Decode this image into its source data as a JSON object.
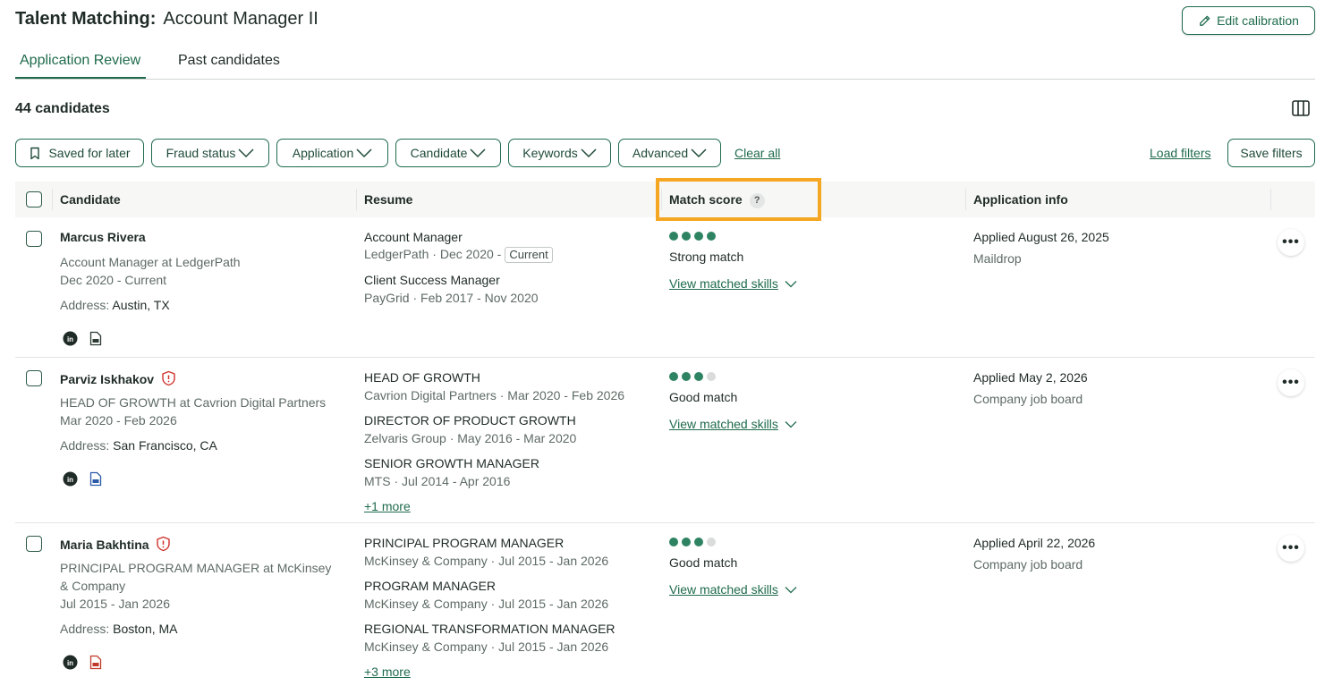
{
  "header": {
    "title_prefix": "Talent Matching:",
    "job_title": "Account Manager II",
    "edit_label": "Edit calibration"
  },
  "tabs": [
    {
      "label": "Application Review",
      "active": true
    },
    {
      "label": "Past candidates",
      "active": false
    }
  ],
  "count_label": "44 candidates",
  "filters": {
    "saved_label": "Saved for later",
    "items": [
      "Fraud status",
      "Application",
      "Candidate",
      "Keywords",
      "Advanced"
    ],
    "clear_label": "Clear all",
    "load_label": "Load filters",
    "save_label": "Save filters"
  },
  "table": {
    "headers": {
      "candidate": "Candidate",
      "resume": "Resume",
      "match": "Match score",
      "match_help": "?",
      "app_info": "Application info"
    },
    "address_prefix": "Address:",
    "skills_label": "View matched skills",
    "more_actions": "•••",
    "rows": [
      {
        "name": "Marcus Rivera",
        "fraud_flag": false,
        "headline": "Account Manager at LedgerPath",
        "dates": "Dec 2020 - Current",
        "address": "Austin, TX",
        "resume": [
          {
            "title": "Account Manager",
            "detail": "LedgerPath · Dec 2020 -",
            "badge": "Current"
          },
          {
            "title": "Client Success Manager",
            "detail": "PayGrid · Feb 2017 - Nov 2020"
          }
        ],
        "more": "",
        "score": 4,
        "match_label": "Strong match",
        "applied": "Applied August 26, 2025",
        "source": "Maildrop",
        "resume_icon_color": "#2b3a33"
      },
      {
        "name": "Parviz Iskhakov",
        "fraud_flag": true,
        "headline": "HEAD OF GROWTH at Cavrion Digital Partners",
        "dates": "Mar 2020 - Feb 2026",
        "address": "San Francisco, CA",
        "resume": [
          {
            "title": "HEAD OF GROWTH",
            "detail": "Cavrion Digital Partners · Mar 2020 - Feb 2026"
          },
          {
            "title": "DIRECTOR OF PRODUCT GROWTH",
            "detail": "Zelvaris Group · May 2016 - Mar 2020"
          },
          {
            "title": "SENIOR GROWTH MANAGER",
            "detail": "MTS · Jul 2014 - Apr 2016"
          }
        ],
        "more": "+1 more",
        "score": 3,
        "match_label": "Good match",
        "applied": "Applied May 2, 2026",
        "source": "Company job board",
        "resume_icon_color": "#2b5aa8"
      },
      {
        "name": "Maria Bakhtina",
        "fraud_flag": true,
        "headline_1": "PRINCIPAL PROGRAM MANAGER at McKinsey",
        "headline_2": "& Company",
        "dates": "Jul 2015 - Jan 2026",
        "address": "Boston, MA",
        "resume": [
          {
            "title": "PRINCIPAL PROGRAM MANAGER",
            "detail": "McKinsey & Company · Jul 2015 - Jan 2026"
          },
          {
            "title": "PROGRAM MANAGER",
            "detail": "McKinsey & Company · Jul 2015 - Jan 2026"
          },
          {
            "title": "REGIONAL TRANSFORMATION MANAGER",
            "detail": "McKinsey & Company · Jul 2015 - Jan 2026"
          }
        ],
        "more": "+3 more",
        "score": 3,
        "match_label": "Good match",
        "applied": "Applied April 22, 2026",
        "source": "Company job board",
        "resume_icon_color": "#c0392b"
      }
    ]
  },
  "colors": {
    "accent": "#1f6b4d",
    "dot_on": "#2e8462",
    "dot_off": "#d9dcdb",
    "highlight": "#f5a623",
    "warning": "#d0312d"
  }
}
